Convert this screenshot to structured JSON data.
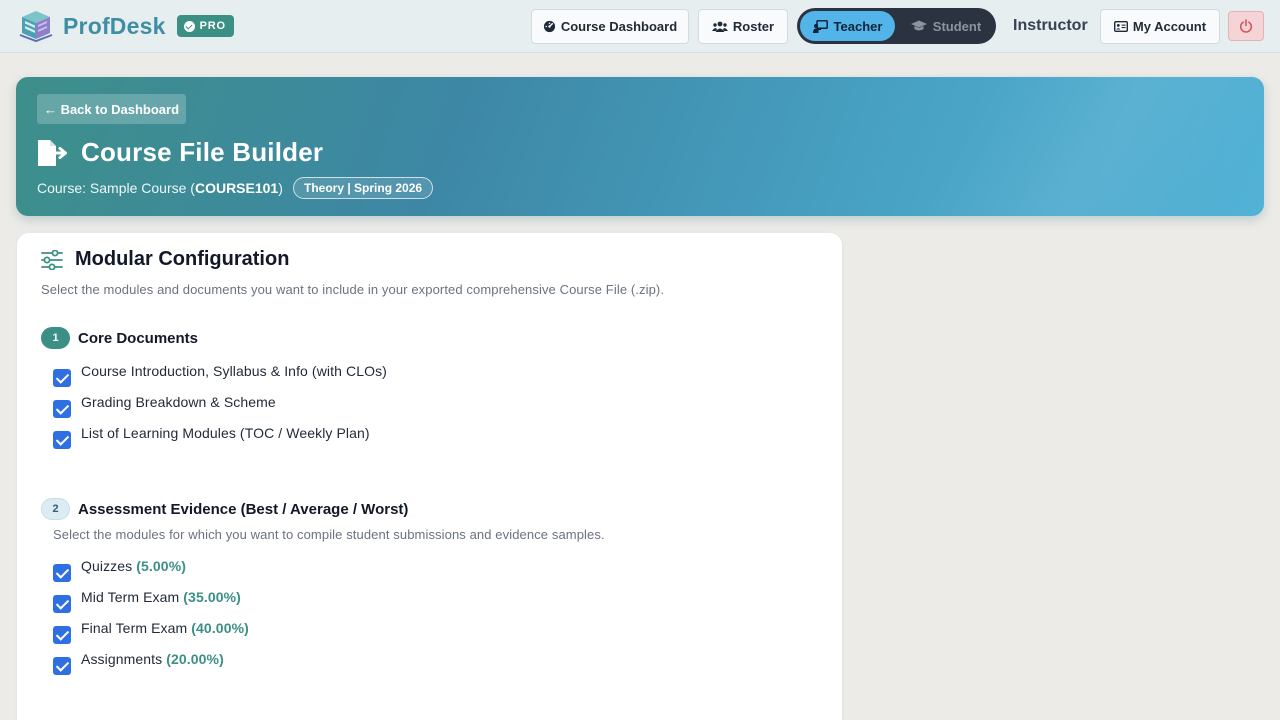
{
  "app": {
    "name": "ProfDesk",
    "badge": "PRO",
    "colors": {
      "brand": "#3f8ea3",
      "accent": "#3c8f85",
      "checkbox": "#2f6fe4",
      "teacher_active": "#52b4e8"
    }
  },
  "nav": {
    "course_dashboard": "Course Dashboard",
    "roster": "Roster",
    "role_toggle": {
      "teacher": "Teacher",
      "student": "Student",
      "active": "Teacher"
    },
    "user_role": "Instructor",
    "my_account": "My Account"
  },
  "hero": {
    "back_label": "← Back to Dashboard",
    "title": "Course File Builder",
    "course_prefix": "Course: Sample Course (",
    "course_code": "COURSE101",
    "course_suffix": ")",
    "term_pill": "Theory | Spring 2026"
  },
  "config": {
    "title": "Modular Configuration",
    "description": "Select the modules and documents you want to include in your exported comprehensive Course File (.zip).",
    "sections": [
      {
        "number": "1",
        "title": "Core Documents",
        "items": [
          {
            "label": "Course Introduction, Syllabus & Info (with CLOs)",
            "checked": true
          },
          {
            "label": "Grading Breakdown & Scheme",
            "checked": true
          },
          {
            "label": "List of Learning Modules (TOC / Weekly Plan)",
            "checked": true
          }
        ]
      },
      {
        "number": "2",
        "title": "Assessment Evidence (Best / Average / Worst)",
        "description": "Select the modules for which you want to compile student submissions and evidence samples.",
        "items": [
          {
            "label": "Quizzes",
            "weight": "(5.00%)",
            "checked": true
          },
          {
            "label": "Mid Term Exam",
            "weight": "(35.00%)",
            "checked": true
          },
          {
            "label": "Final Term Exam",
            "weight": "(40.00%)",
            "checked": true
          },
          {
            "label": "Assignments",
            "weight": "(20.00%)",
            "checked": true
          }
        ]
      }
    ]
  }
}
